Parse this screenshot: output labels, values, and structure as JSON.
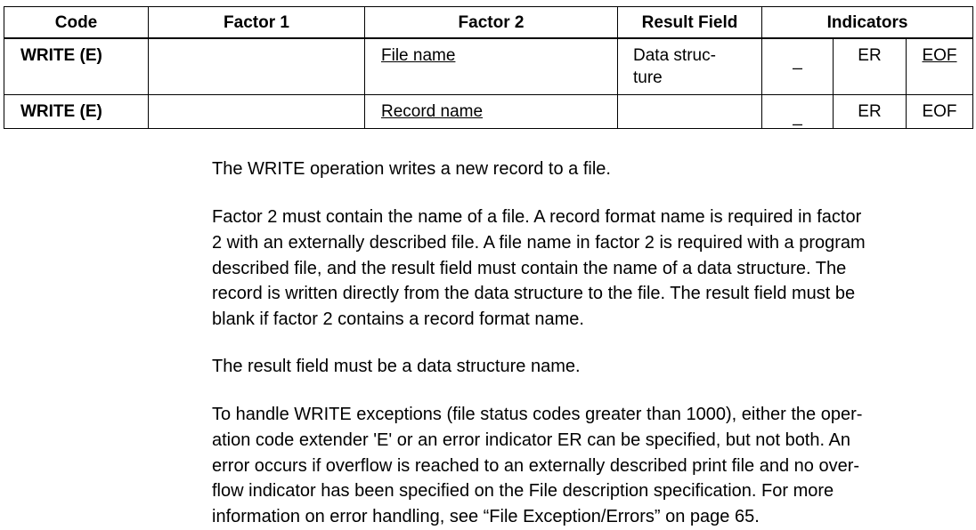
{
  "table": {
    "headers": {
      "code": "Code",
      "factor1": "Factor 1",
      "factor2": "Factor 2",
      "result": "Result Field",
      "indicators": "Indicators"
    },
    "rows": [
      {
        "code": "WRITE (E)",
        "factor1": "",
        "factor2": "File name",
        "result_line1": "Data struc-",
        "result_line2": "ture",
        "ind1": "_",
        "ind2": "ER",
        "ind3": "EOF"
      },
      {
        "code": "WRITE (E)",
        "factor1": "",
        "factor2": "Record name",
        "result_line1": "",
        "result_line2": "",
        "ind1": "_",
        "ind2": "ER",
        "ind3": "EOF"
      }
    ]
  },
  "paragraphs": [
    [
      "The WRITE operation writes a new record to a file."
    ],
    [
      "Factor 2 must contain the name of a file. A record format name is required in factor",
      "2 with an externally described file. A file name in factor 2 is required with a program",
      "described file, and the result field must contain the name of a data structure. The",
      "record is written directly from the data structure to the file. The result field must be",
      "blank if factor 2 contains a record format name."
    ],
    [
      "The result field must be a data structure name."
    ],
    [
      "To handle WRITE exceptions (file status codes greater than 1000), either the oper-",
      "ation code extender 'E' or an error indicator ER can be specified, but not both. An",
      "error occurs if overflow is reached to an externally described print file and no over-",
      "flow indicator has been specified on the File description specification. For more",
      "information on error handling, see “File Exception/Errors” on page  65."
    ]
  ]
}
